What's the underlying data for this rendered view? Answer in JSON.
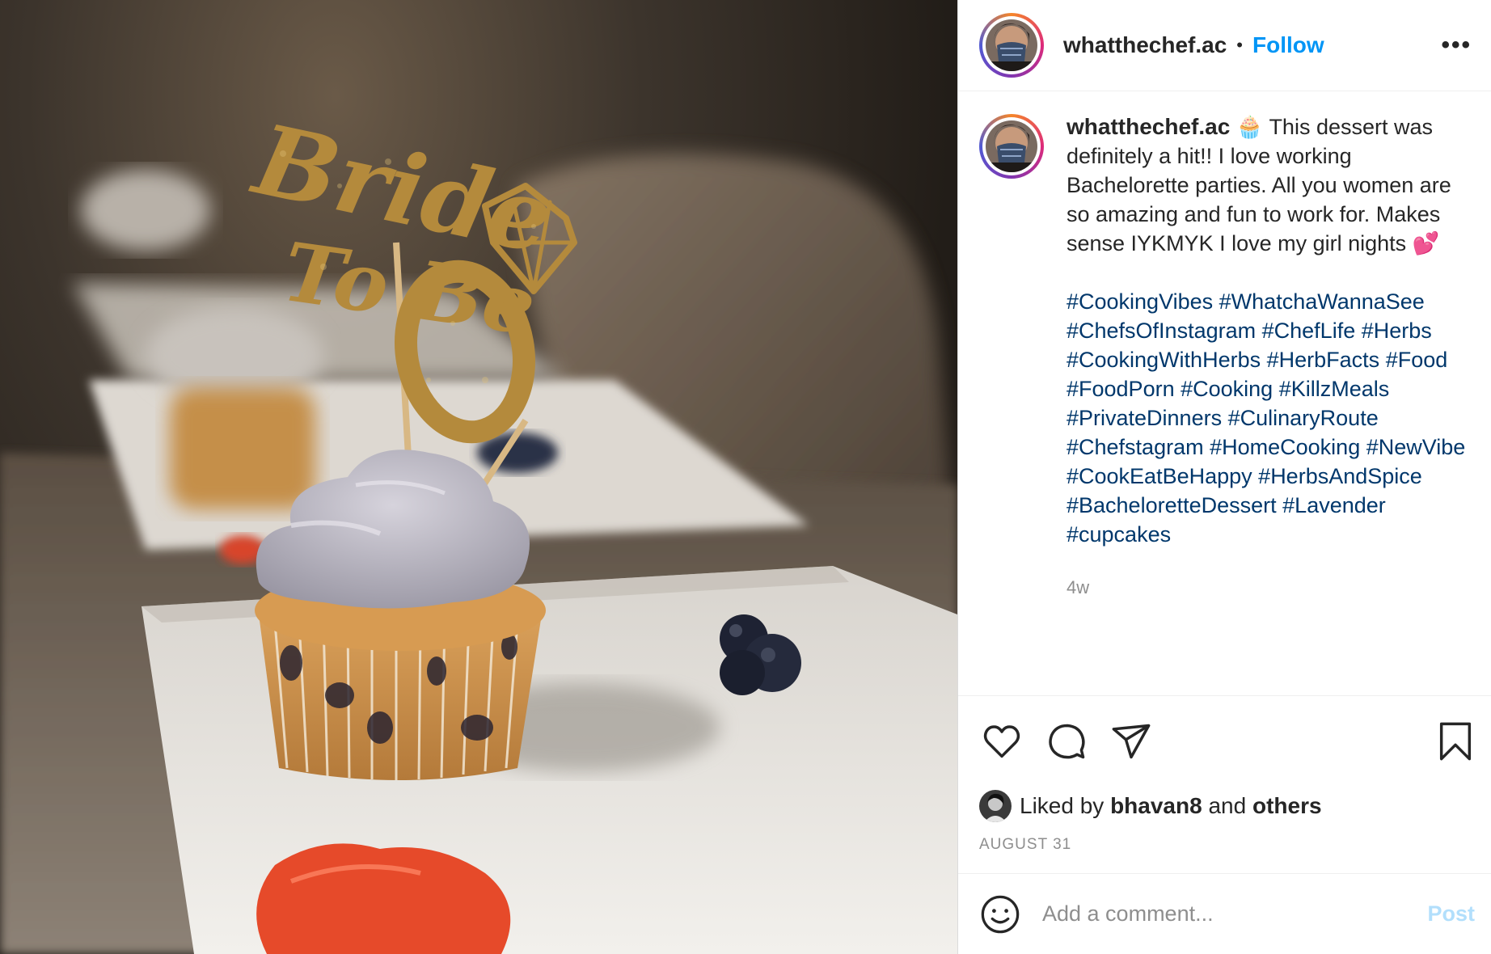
{
  "header": {
    "username": "whatthechef.ac",
    "separator": "•",
    "follow_label": "Follow",
    "more_label": "•••"
  },
  "caption": {
    "username": "whatthechef.ac",
    "emoji_cupcake": "🧁",
    "text": "This dessert was definitely a hit!! I love working Bachelorette parties. All you women are so amazing and fun to work for. Makes sense IYKMYK I love my girl nights",
    "emoji_hearts": "💕",
    "hashtags": [
      "#CookingVibes",
      "#WhatchaWannaSee",
      "#ChefsOfInstagram",
      "#ChefLife",
      "#Herbs",
      "#CookingWithHerbs",
      "#HerbFacts",
      "#Food",
      "#FoodPorn",
      "#Cooking",
      "#KillzMeals",
      "#PrivateDinners",
      "#CulinaryRoute",
      "#Chefstagram",
      "#HomeCooking",
      "#NewVibe",
      "#CookEatBeHappy",
      "#HerbsAndSpice",
      "#BacheloretteDessert",
      "#Lavender",
      "#cupcakes"
    ],
    "time_ago": "4w"
  },
  "icons": {
    "like": "heart-icon",
    "comment": "comment-icon",
    "share": "paper-plane-icon",
    "save": "bookmark-icon",
    "emoji": "smiley-icon"
  },
  "likes": {
    "prefix": "Liked by",
    "user": "bhavan8",
    "conjunction": "and",
    "others": "others"
  },
  "date": "AUGUST 31",
  "comment_box": {
    "placeholder": "Add a comment...",
    "post_label": "Post"
  },
  "photo": {
    "topper_text": "Bride To Be"
  },
  "colors": {
    "follow": "#0095f6",
    "hashtag": "#00376b",
    "post_disabled": "#b2dffc",
    "muted": "#8e8e8e"
  }
}
